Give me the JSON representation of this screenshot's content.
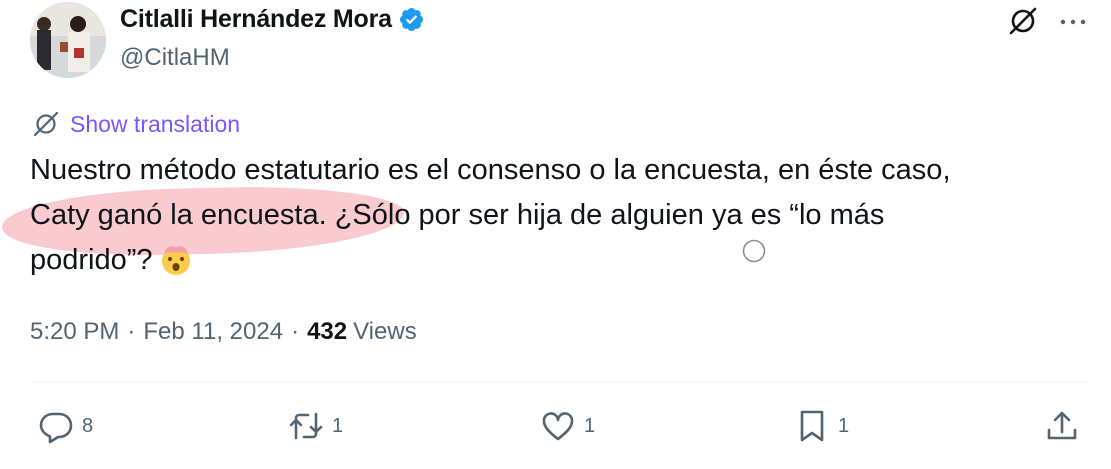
{
  "author": {
    "name": "Citlalli Hernández Mora",
    "handle": "@CitlaHM",
    "verified": true,
    "verified_color": "#1d9bf0"
  },
  "translate": {
    "label": "Show translation",
    "color": "#7856ff",
    "icon": "globe-slash-icon"
  },
  "tweet": {
    "line1": "Nuestro método estatutario es el consenso o la encuesta, en éste caso,",
    "line2_highlighted": "Caty ganó la encuesta.",
    "line2_rest": " ¿Sólo por ser hija de alguien ya es “lo más",
    "line3": "podrido”?",
    "emoji": "exploding-head-emoji",
    "highlight_color": "#f7b8bd"
  },
  "meta": {
    "time": "5:20 PM",
    "separator": "·",
    "date": "Feb 11, 2024",
    "views_count": "432",
    "views_label": "Views"
  },
  "actions": {
    "reply_count": "8",
    "retweet_count": "1",
    "like_count": "1",
    "bookmark_count": "1"
  },
  "icons": {
    "top_right_1": "grok-slash-icon",
    "top_right_2": "more-icon"
  }
}
